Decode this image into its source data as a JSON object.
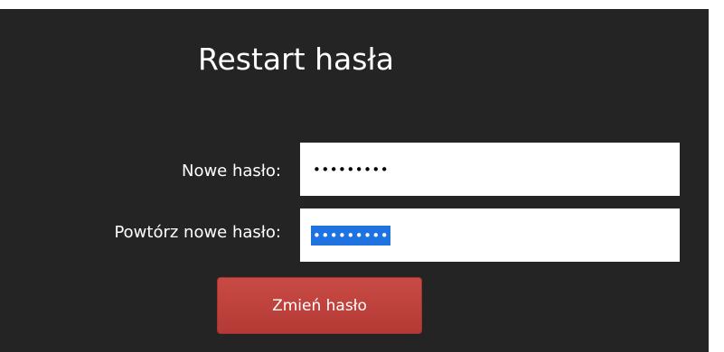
{
  "form": {
    "title": "Restart hasła",
    "new_password_label": "Nowe hasło:",
    "new_password_value": "•••••••••",
    "repeat_password_label": "Powtórz nowe hasło:",
    "repeat_password_value": "•••••••••",
    "submit_label": "Zmień hasło"
  },
  "colors": {
    "panel_background": "#242424",
    "button": "#bc3f3a",
    "selection": "#1e73e0"
  }
}
